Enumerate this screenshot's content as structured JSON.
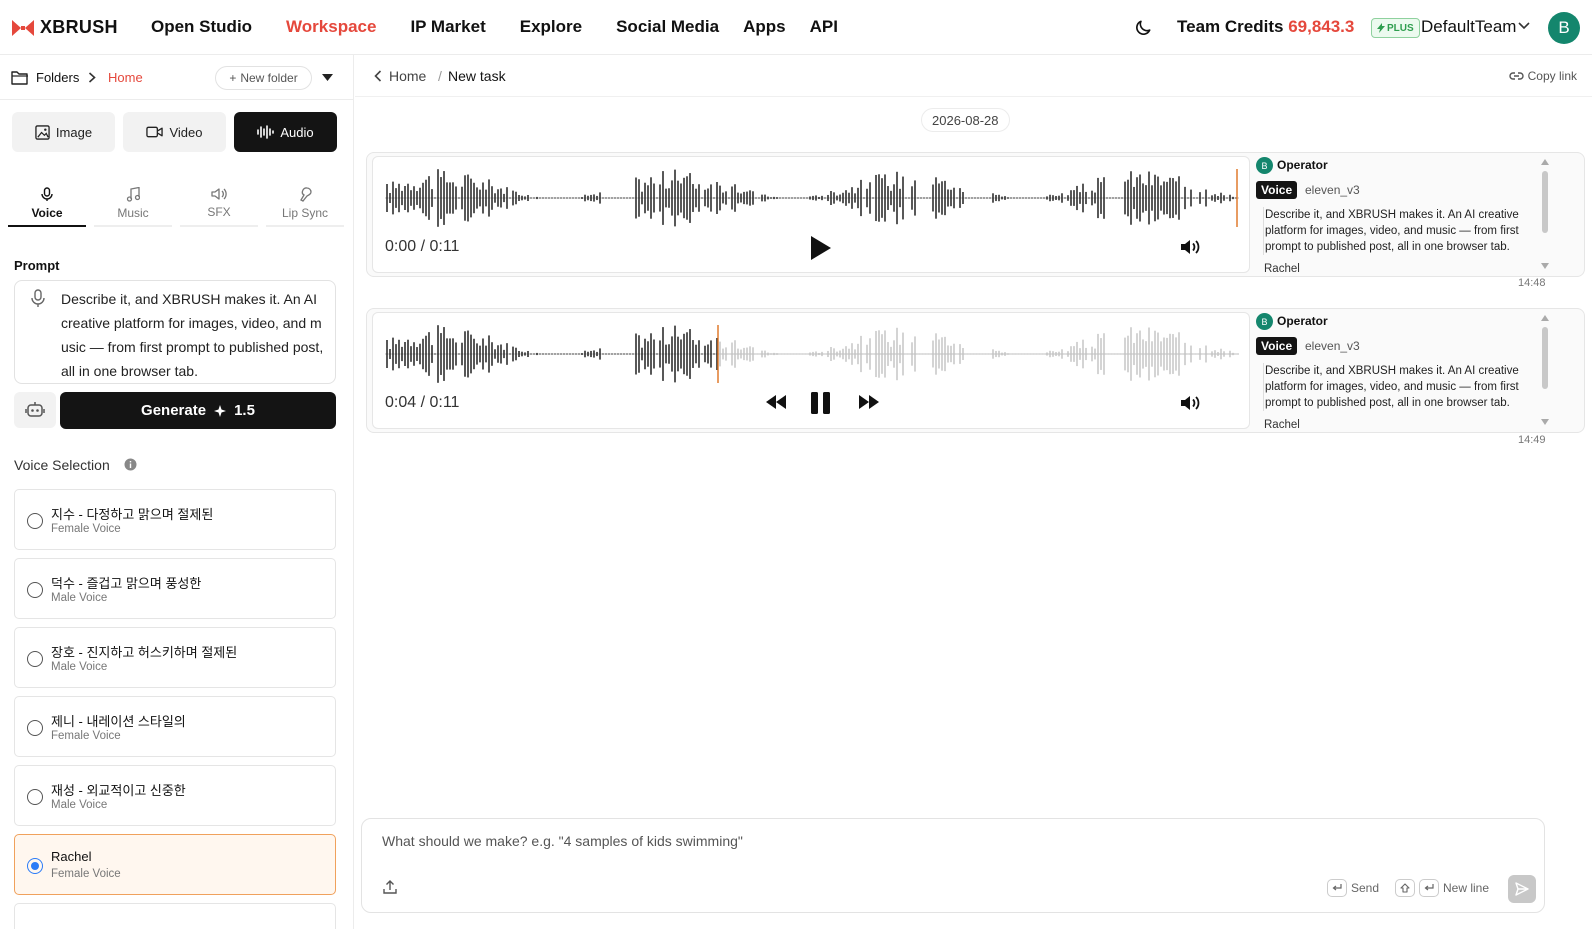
{
  "app": {
    "logo_text": "XBRUSH",
    "brand_color": "#e5483c"
  },
  "nav": {
    "items": [
      "Open Studio",
      "Workspace",
      "IP Market",
      "Explore",
      "Social Media",
      "Apps",
      "API"
    ],
    "active": "Workspace"
  },
  "account": {
    "credits_label": "Team Credits",
    "credits_value": "69,843.3",
    "plan_badge": "PLUS",
    "team_name": "DefaultTeam",
    "avatar_initial": "B"
  },
  "sidebar": {
    "folders_label": "Folders",
    "home_crumb": "Home",
    "new_folder_label": "New folder",
    "media_tabs": [
      "Image",
      "Video",
      "Audio"
    ],
    "active_media_tab": "Audio",
    "sub_tabs": [
      "Voice",
      "Music",
      "SFX",
      "Lip Sync"
    ],
    "active_sub_tab": "Voice",
    "prompt_label": "Prompt",
    "prompt_text": "Describe it, and XBRUSH makes it. An AI creative platform for images, video, and music — from first prompt to published post, all in one browser tab.",
    "generate_label": "Generate",
    "generate_cost": "1.5",
    "voice_selection_label": "Voice Selection",
    "voices": [
      {
        "name": "지수 - 다정하고 맑으며 절제된",
        "type": "Female Voice",
        "selected": false
      },
      {
        "name": "덕수 - 즐겁고 맑으며 풍성한",
        "type": "Male Voice",
        "selected": false
      },
      {
        "name": "장호 - 진지하고 허스키하며 절제된",
        "type": "Male Voice",
        "selected": false
      },
      {
        "name": "제니 - 내레이션 스타일의",
        "type": "Female Voice",
        "selected": false
      },
      {
        "name": "재성 - 외교적이고 신중한",
        "type": "Male Voice",
        "selected": false
      },
      {
        "name": "Rachel",
        "type": "Female Voice",
        "selected": true
      }
    ]
  },
  "main": {
    "breadcrumb_home": "Home",
    "breadcrumb_sep": "/",
    "breadcrumb_current": "New task",
    "copy_link_label": "Copy link",
    "date_chip": "2026-08-28",
    "results": [
      {
        "time_display": "0:00 / 0:11",
        "state": "paused",
        "progress": 0.0,
        "operator_initial": "B",
        "operator_name": "Operator",
        "voice_tag": "Voice",
        "model": "eleven_v3",
        "description": "Describe it, and XBRUSH makes it. An AI creative platform for images, video, and music — from first prompt to published post, all in one browser tab.",
        "voice_name": "Rachel",
        "timestamp": "14:48"
      },
      {
        "time_display": "0:04 / 0:11",
        "state": "playing",
        "progress": 0.39,
        "operator_initial": "B",
        "operator_name": "Operator",
        "voice_tag": "Voice",
        "model": "eleven_v3",
        "description": "Describe it, and XBRUSH makes it. An AI creative platform for images, video, and music — from first prompt to published post, all in one browser tab.",
        "voice_name": "Rachel",
        "timestamp": "14:49"
      }
    ],
    "composer": {
      "placeholder": "What should we make? e.g. \"4 samples of kids swimming\"",
      "send_hint": "Send",
      "newline_hint": "New line"
    }
  }
}
